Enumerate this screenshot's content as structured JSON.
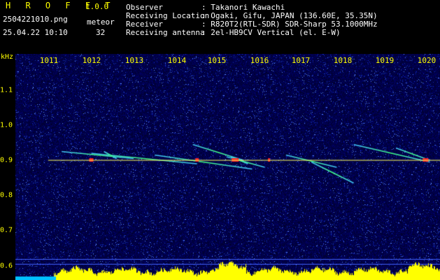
{
  "header": {
    "app_name": "H R O F F T",
    "version": "1.0.0",
    "filename": "2504221010.png",
    "mode": "meteor",
    "datetime": "25.04.22 10:10",
    "count": "32",
    "fields": [
      {
        "label": "Observer",
        "value": ": Takanori Kawachi"
      },
      {
        "label": "Receiving Location",
        "value": ": Ogaki, Gifu, JAPAN (136.60E, 35.35N)"
      },
      {
        "label": "Receiver",
        "value": ": R820T2(RTL-SDR) SDR-Sharp 53.1000MHz"
      },
      {
        "label": "Receiving antenna",
        "value": ": 2el-HB9CV Vertical (el. E-W)"
      }
    ]
  },
  "axis": {
    "unit": "kHz",
    "time_labels": [
      "1011",
      "1012",
      "1013",
      "1014",
      "1015",
      "1016",
      "1017",
      "1018",
      "1019",
      "1020"
    ],
    "freq_labels": [
      "1.1",
      "1.0",
      "0.9",
      "0.8",
      "0.7",
      "0.6"
    ]
  },
  "colors": {
    "background": "#00003a",
    "text": "#ffffff",
    "accent": "#ffff00",
    "carrier": "#ffff60",
    "echo_hot": "#ff2020",
    "echo_mid": "#40ff80",
    "echo_cool": "#40c0ff"
  },
  "spectrogram": {
    "carrier_freq_khz": 0.9,
    "echoes": [
      {
        "t0": 1011.3,
        "f0": 0.925,
        "t1": 1013.0,
        "f1": 0.905
      },
      {
        "t0": 1012.0,
        "f0": 0.92,
        "t1": 1014.5,
        "f1": 0.89
      },
      {
        "t0": 1013.5,
        "f0": 0.915,
        "t1": 1015.8,
        "f1": 0.875
      },
      {
        "t0": 1014.4,
        "f0": 0.945,
        "t1": 1015.6,
        "f1": 0.9
      },
      {
        "t0": 1015.2,
        "f0": 0.91,
        "t1": 1016.1,
        "f1": 0.88
      },
      {
        "t0": 1016.6,
        "f0": 0.915,
        "t1": 1017.8,
        "f1": 0.88
      },
      {
        "t0": 1017.2,
        "f0": 0.895,
        "t1": 1018.2,
        "f1": 0.835
      },
      {
        "t0": 1018.2,
        "f0": 0.945,
        "t1": 1020.0,
        "f1": 0.895
      },
      {
        "t0": 1019.2,
        "f0": 0.935,
        "t1": 1020.0,
        "f1": 0.9
      },
      {
        "t0": 1012.3,
        "f0": 0.925,
        "t1": 1012.6,
        "f1": 0.905
      },
      {
        "t0": 1015.3,
        "f0": 0.91,
        "t1": 1015.7,
        "f1": 0.89
      }
    ]
  }
}
